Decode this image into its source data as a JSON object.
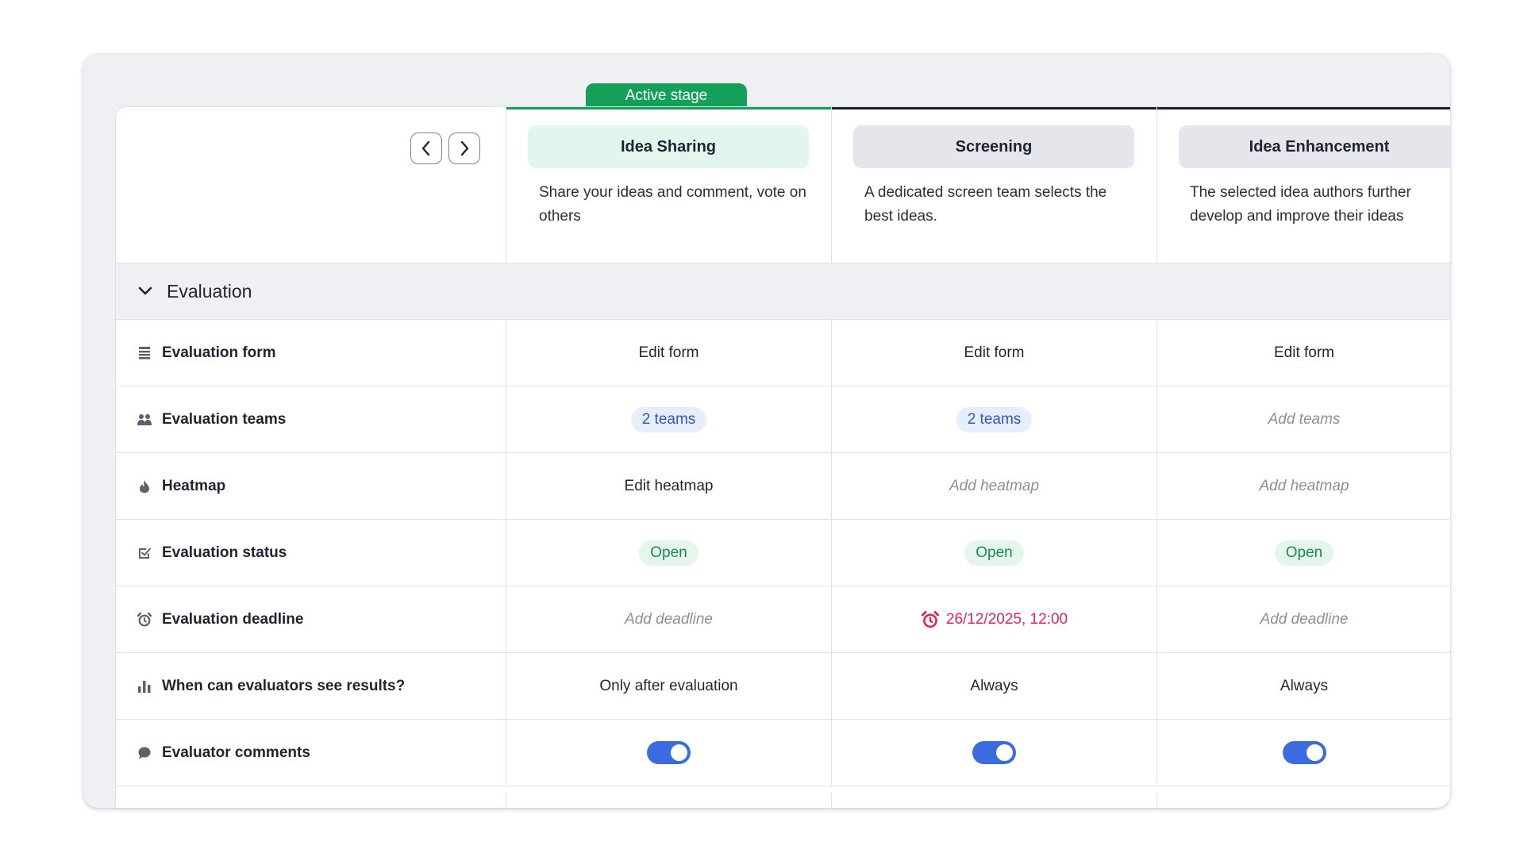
{
  "active_stage_tag": "Active stage",
  "colors": {
    "active_green": "#15a05a",
    "active_pill_bg": "#e2f6ee",
    "inactive_pill_bg": "#e4e6eb",
    "inactive_topline": "#1c2233",
    "toggle_blue": "#3a6be0",
    "deadline_red": "#e0245e"
  },
  "stages": [
    {
      "name": "Idea Sharing",
      "description": "Share your ideas and comment, vote on others",
      "active": true
    },
    {
      "name": "Screening",
      "description": "A dedicated screen team selects the best ideas.",
      "active": false
    },
    {
      "name": "Idea Enhancement",
      "description": "The selected idea authors further develop and improve their ideas",
      "active": false
    }
  ],
  "section": {
    "title": "Evaluation",
    "icon": "chevron-down-icon",
    "expanded": true
  },
  "rows": [
    {
      "label": "Evaluation form",
      "icon": "form-icon",
      "values": [
        {
          "text": "Edit form",
          "style": "plain"
        },
        {
          "text": "Edit form",
          "style": "plain"
        },
        {
          "text": "Edit form",
          "style": "plain"
        }
      ]
    },
    {
      "label": "Evaluation teams",
      "icon": "team-icon",
      "values": [
        {
          "text": "2 teams",
          "style": "chip-blue"
        },
        {
          "text": "2 teams",
          "style": "chip-blue"
        },
        {
          "text": "Add teams",
          "style": "muted"
        }
      ]
    },
    {
      "label": "Heatmap",
      "icon": "flame-icon",
      "values": [
        {
          "text": "Edit heatmap",
          "style": "plain"
        },
        {
          "text": "Add heatmap",
          "style": "muted"
        },
        {
          "text": "Add heatmap",
          "style": "muted"
        }
      ]
    },
    {
      "label": "Evaluation status",
      "icon": "checkbox-icon",
      "values": [
        {
          "text": "Open",
          "style": "chip-green"
        },
        {
          "text": "Open",
          "style": "chip-green"
        },
        {
          "text": "Open",
          "style": "chip-green"
        }
      ]
    },
    {
      "label": "Evaluation deadline",
      "icon": "alarm-icon",
      "values": [
        {
          "text": "Add deadline",
          "style": "muted"
        },
        {
          "text": "26/12/2025, 12:00",
          "style": "deadline"
        },
        {
          "text": "Add deadline",
          "style": "muted"
        }
      ]
    },
    {
      "label": "When can evaluators see results?",
      "icon": "bar-chart-icon",
      "values": [
        {
          "text": "Only after evaluation",
          "style": "plain"
        },
        {
          "text": "Always",
          "style": "plain"
        },
        {
          "text": "Always",
          "style": "plain"
        }
      ]
    },
    {
      "label": "Evaluator comments",
      "icon": "comment-icon",
      "values": [
        {
          "toggle": true
        },
        {
          "toggle": true
        },
        {
          "toggle": true
        }
      ]
    }
  ]
}
